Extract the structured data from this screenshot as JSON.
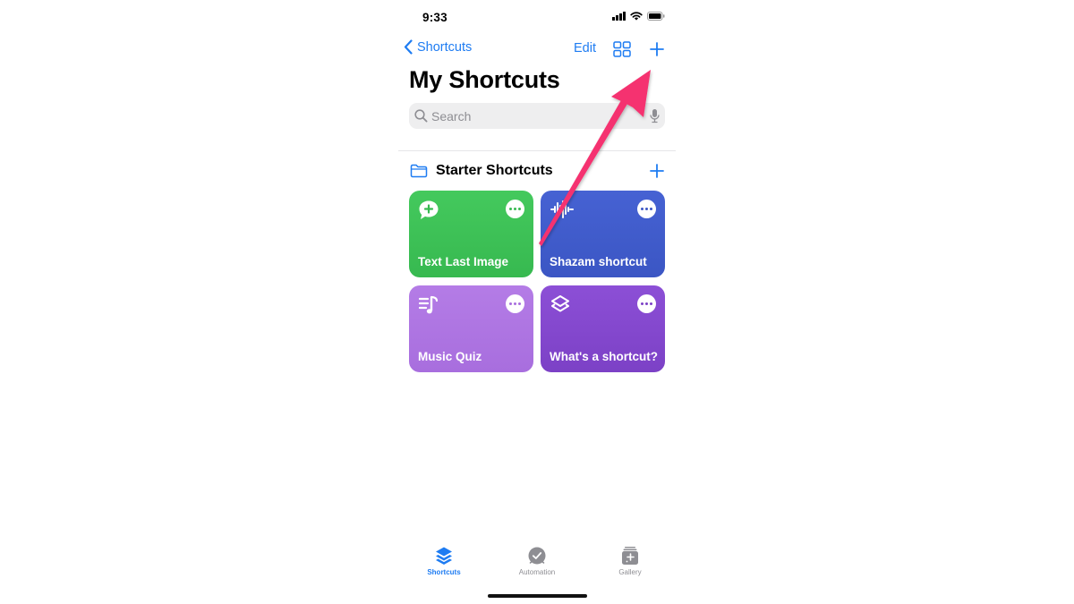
{
  "status_bar": {
    "time": "9:33",
    "icons": [
      "cellular-signal-icon",
      "wifi-icon",
      "battery-icon"
    ]
  },
  "nav": {
    "back_label": "Shortcuts",
    "edit_label": "Edit",
    "grid_icon": "grid-view-icon",
    "add_icon": "plus-icon"
  },
  "page": {
    "title": "My Shortcuts"
  },
  "search": {
    "placeholder": "Search",
    "value": "",
    "icon": "magnifying-glass-icon",
    "mic_icon": "microphone-icon"
  },
  "section": {
    "title": "Starter Shortcuts",
    "icon": "folder-icon",
    "add_icon": "plus-icon"
  },
  "shortcuts": [
    {
      "label": "Text Last Image",
      "icon": "message-plus-icon",
      "color": "#3fc157"
    },
    {
      "label": "Shazam shortcut",
      "icon": "waveform-icon",
      "color": "#4260cf"
    },
    {
      "label": "Music Quiz",
      "icon": "music-list-icon",
      "color": "#b176e3"
    },
    {
      "label": "What's a shortcut?",
      "icon": "layers-icon",
      "color": "#8548cf"
    }
  ],
  "tabbar": {
    "tabs": [
      {
        "label": "Shortcuts",
        "icon": "layers-icon",
        "active": true
      },
      {
        "label": "Automation",
        "icon": "clock-check-icon",
        "active": false
      },
      {
        "label": "Gallery",
        "icon": "gallery-sparkle-icon",
        "active": false
      }
    ]
  },
  "annotation": {
    "type": "arrow",
    "color": "#f5316f",
    "points_to": "nav-add-button"
  },
  "colors": {
    "accent": "#1e7cf2",
    "inactive": "#8e8e93"
  }
}
